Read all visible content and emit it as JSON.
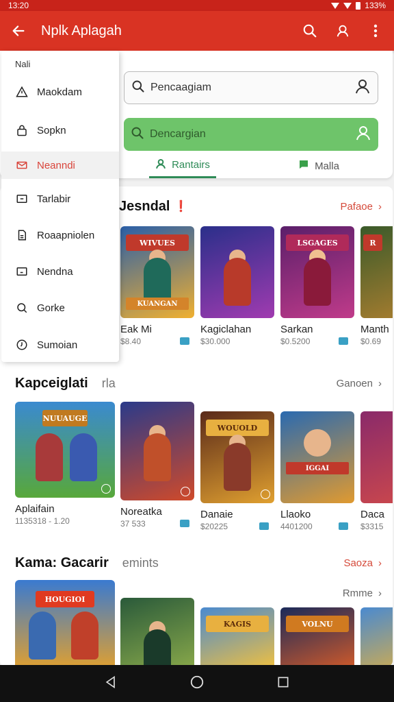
{
  "status": {
    "time": "13:20",
    "right": "133%"
  },
  "appbar": {
    "title": "Nplk Aplagah"
  },
  "search": {
    "primary_placeholder": "Pencaagiam",
    "secondary_placeholder": "Dencargian"
  },
  "tabs": [
    {
      "label": "Rantairs"
    },
    {
      "label": "Malla"
    }
  ],
  "drawer": {
    "header": "Nali",
    "items": [
      {
        "label": "Maokdam",
        "icon": "warning-icon"
      },
      {
        "label": "Sopkn",
        "icon": "lock-icon"
      },
      {
        "label": "Neanndi",
        "icon": "mail-icon"
      },
      {
        "label": "Tarlabir",
        "icon": "folder-icon"
      },
      {
        "label": "Roaapniolen",
        "icon": "document-icon"
      },
      {
        "label": "Nendna",
        "icon": "frame-icon"
      },
      {
        "label": "Gorke",
        "icon": "search-icon"
      },
      {
        "label": "Sumoian",
        "icon": "clock-icon"
      }
    ]
  },
  "sections": [
    {
      "title": "Jesndal",
      "subtitle": "",
      "more": "Pafaoe",
      "cards": [
        {
          "name": "Eak Mi",
          "meta": "$8.40",
          "banner": "WIVUES",
          "logo": "KUANGAN",
          "bg": [
            "#2a5fa8",
            "#f0b030"
          ]
        },
        {
          "name": "Kagiclahan",
          "meta": "$30.000",
          "banner": "",
          "logo": "",
          "bg": [
            "#2a2f8a",
            "#a03bb0"
          ]
        },
        {
          "name": "Sarkan",
          "meta": "$0.5200",
          "banner": "LSGAGES",
          "logo": "",
          "bg": [
            "#5a1f6a",
            "#c03b8a"
          ]
        },
        {
          "name": "Manth",
          "meta": "$0.69",
          "banner": "R",
          "logo": "",
          "bg": [
            "#3a5a2a",
            "#b08030"
          ]
        }
      ]
    },
    {
      "title": "Kapceiglati",
      "subtitle": "rla",
      "more": "Ganoen",
      "cards": [
        {
          "name": "Aplaifain",
          "meta": "1135318 - 1.20",
          "banner": "NUUAUGE",
          "logo": "",
          "bg": [
            "#3a8ad0",
            "#58a83a"
          ]
        },
        {
          "name": "Noreatka",
          "meta": "37 533",
          "banner": "",
          "logo": "",
          "bg": [
            "#2a3a8a",
            "#d04a2a"
          ]
        },
        {
          "name": "Danaie",
          "meta": "$20225",
          "banner": "WOUOLD",
          "logo": "",
          "bg": [
            "#5a2a1a",
            "#e0a030"
          ]
        },
        {
          "name": "Llaoko",
          "meta": "4401200",
          "banner": "",
          "logo": "IGGAI",
          "bg": [
            "#2a6ab0",
            "#e09a30"
          ]
        },
        {
          "name": "Daca",
          "meta": "$3315",
          "banner": "",
          "logo": "",
          "bg": [
            "#8a2a6a",
            "#d04a4a"
          ]
        }
      ]
    },
    {
      "title": "Kama: Gacarir",
      "subtitle": "emints",
      "more": "Saoza",
      "more2": "Rmme",
      "cards": [
        {
          "name": "",
          "meta": "",
          "banner": "HOUGIOI",
          "logo": "",
          "bg": [
            "#3a7ad0",
            "#e0a030"
          ]
        },
        {
          "name": "",
          "meta": "",
          "banner": "",
          "logo": "",
          "bg": [
            "#2a5a3a",
            "#88a84a"
          ]
        },
        {
          "name": "",
          "meta": "",
          "banner": "KAGIS",
          "logo": "",
          "bg": [
            "#4a8ad0",
            "#f0c040"
          ]
        },
        {
          "name": "",
          "meta": "",
          "banner": "VOLNU",
          "logo": "",
          "bg": [
            "#1a2a5a",
            "#d05a2a"
          ]
        },
        {
          "name": "",
          "meta": "",
          "banner": "",
          "logo": "",
          "bg": [
            "#4a8ad0",
            "#e0b040"
          ]
        }
      ]
    }
  ],
  "colors": {
    "appbar": "#d93323",
    "accent_green": "#2e8b57",
    "link_red": "#d54a3a"
  }
}
